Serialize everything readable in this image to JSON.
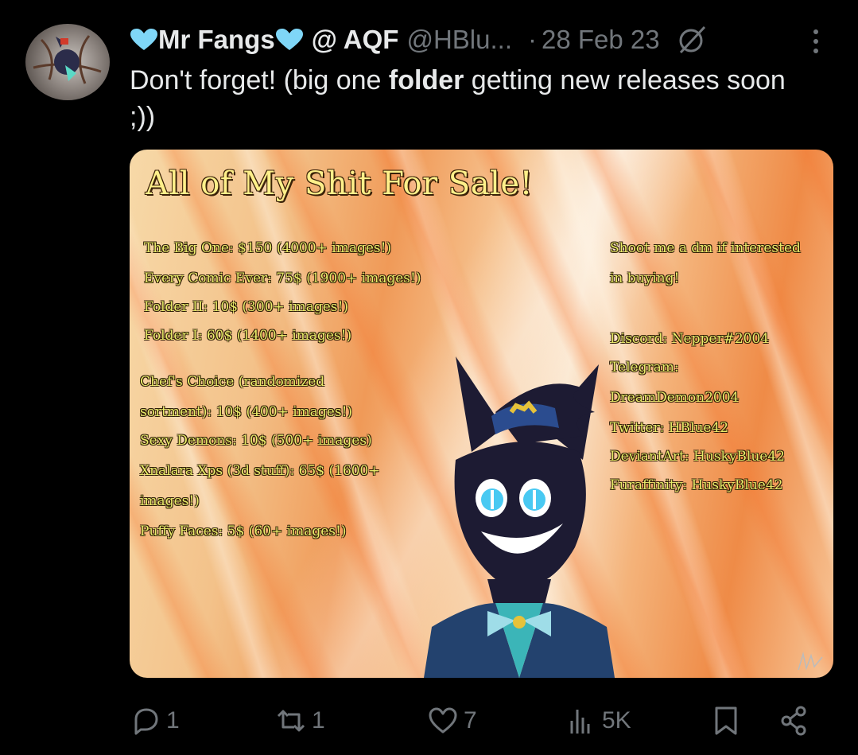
{
  "tweet": {
    "display_name": "Mr Fangs",
    "handle_prefix": "@ AQF",
    "handle": "@HBlu...",
    "separator": "·",
    "date": "28 Feb 23",
    "text_before": "Don't forget! (big one ",
    "text_bold": "folder",
    "text_after": " getting new releases soon ;))"
  },
  "image": {
    "title": "All of My Shit For Sale!",
    "left_lines": [
      "The Big One: $150 (4000+ images!)",
      "Every Comic Ever: 75$ (1900+ images!)",
      "Folder II: 10$ (300+ images!)",
      "Folder I: 60$ (1400+ images!)",
      "Chef's Choice (randomized",
      "sortment): 10$ (400+ images!)",
      "Sexy Demons: 10$ (500+ images)",
      "Xnalara Xps (3d stuff): 65$ (1600+",
      "images!)",
      "Puffy Faces: 5$ (60+ images!)"
    ],
    "right_lines": [
      "Shoot me a dm if interested",
      "in buying!",
      "Discord: Nepper#2004",
      "Telegram:",
      "DreamDemon2004",
      "Twitter: HBlue42",
      "DeviantArt: HuskyBlue42",
      "Furaffinity: HuskyBlue42"
    ]
  },
  "actions": {
    "replies": "1",
    "reposts": "1",
    "likes": "7",
    "views": "5K"
  },
  "colors": {
    "background": "#000000",
    "text": "#e7e9ea",
    "muted": "#71767b",
    "heart_emoji": "#7fd6f7"
  },
  "icons": [
    "avatar",
    "blue-heart-icon",
    "edited-icon",
    "more-icon",
    "reply-icon",
    "repost-icon",
    "like-icon",
    "views-icon",
    "bookmark-icon",
    "share-icon"
  ]
}
